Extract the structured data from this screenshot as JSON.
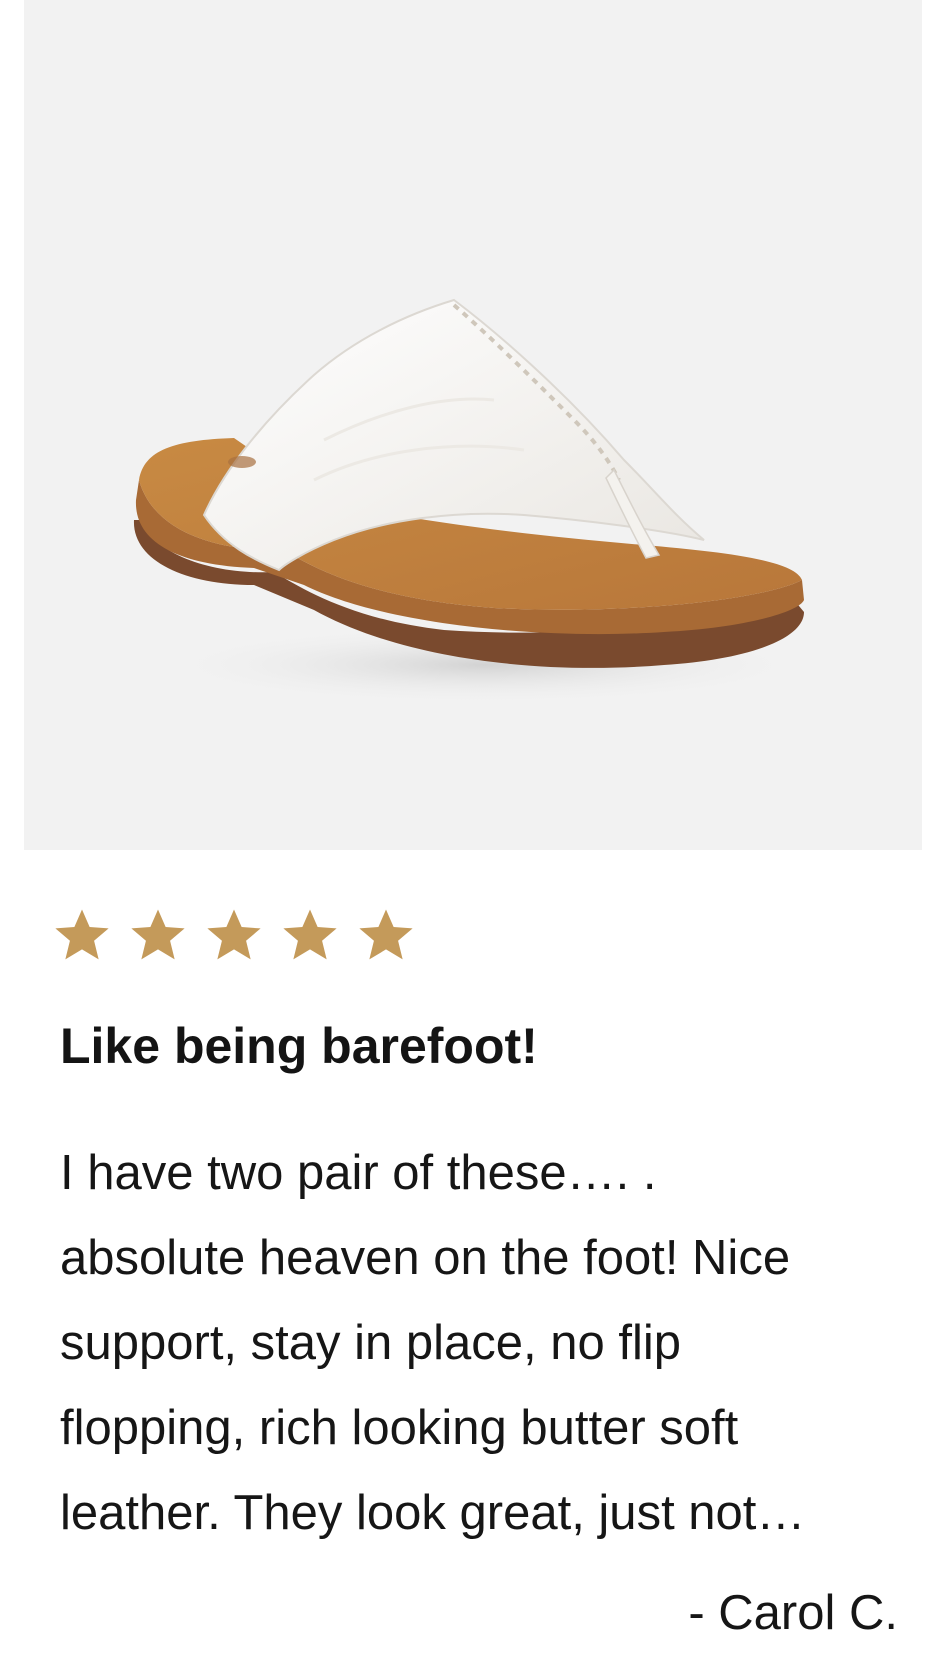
{
  "product": {
    "image_label": "White leather thong sandal with tan footbed"
  },
  "review": {
    "rating": 5,
    "rating_max": 5,
    "star_color": "#c49a5a",
    "title": "Like being barefoot!",
    "body": "I have two pair of these…. .\nabsolute heaven on the foot! Nice\nsupport, stay in place, no flip\nflopping, rich looking butter soft\nleather. They look great, just not…",
    "author": "- Carol C."
  }
}
